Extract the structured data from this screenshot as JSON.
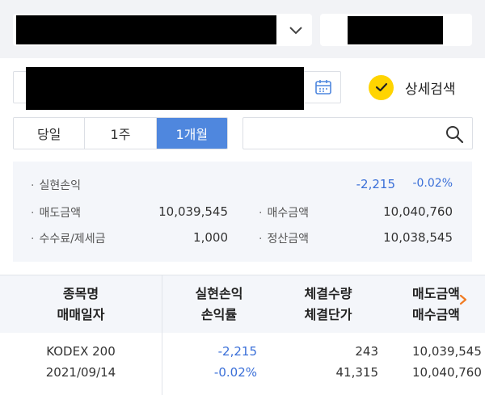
{
  "detail_search": {
    "label": "상세검색"
  },
  "period_tabs": [
    {
      "label": "당일"
    },
    {
      "label": "1주"
    },
    {
      "label": "1개월"
    }
  ],
  "summary": {
    "realized_pl_label": "실현손익",
    "realized_pl_value": "-2,215",
    "realized_pl_rate": "-0.02%",
    "sell_amount_label": "매도금액",
    "sell_amount_value": "10,039,545",
    "buy_amount_label": "매수금액",
    "buy_amount_value": "10,040,760",
    "fee_tax_label": "수수료/제세금",
    "fee_tax_value": "1,000",
    "settlement_label": "정산금액",
    "settlement_value": "10,038,545"
  },
  "table": {
    "headers": {
      "col1_top": "종목명",
      "col1_bottom": "매매일자",
      "col2_top": "실현손익",
      "col2_bottom": "손익률",
      "col3_top": "체결수량",
      "col3_bottom": "체결단가",
      "col4_top": "매도금액",
      "col4_bottom": "매수금액"
    },
    "rows": [
      {
        "name": "KODEX 200",
        "date": "2021/09/14",
        "realized_pl": "-2,215",
        "pl_rate": "-0.02%",
        "quantity": "243",
        "price": "41,315",
        "sell_amount": "10,039,545",
        "buy_amount": "10,040,760"
      }
    ]
  },
  "colors": {
    "accent_blue": "#4f87de",
    "negative_blue": "#3a6fd8",
    "check_yellow": "#ffd400",
    "scroll_arrow_orange": "#f07b22"
  }
}
